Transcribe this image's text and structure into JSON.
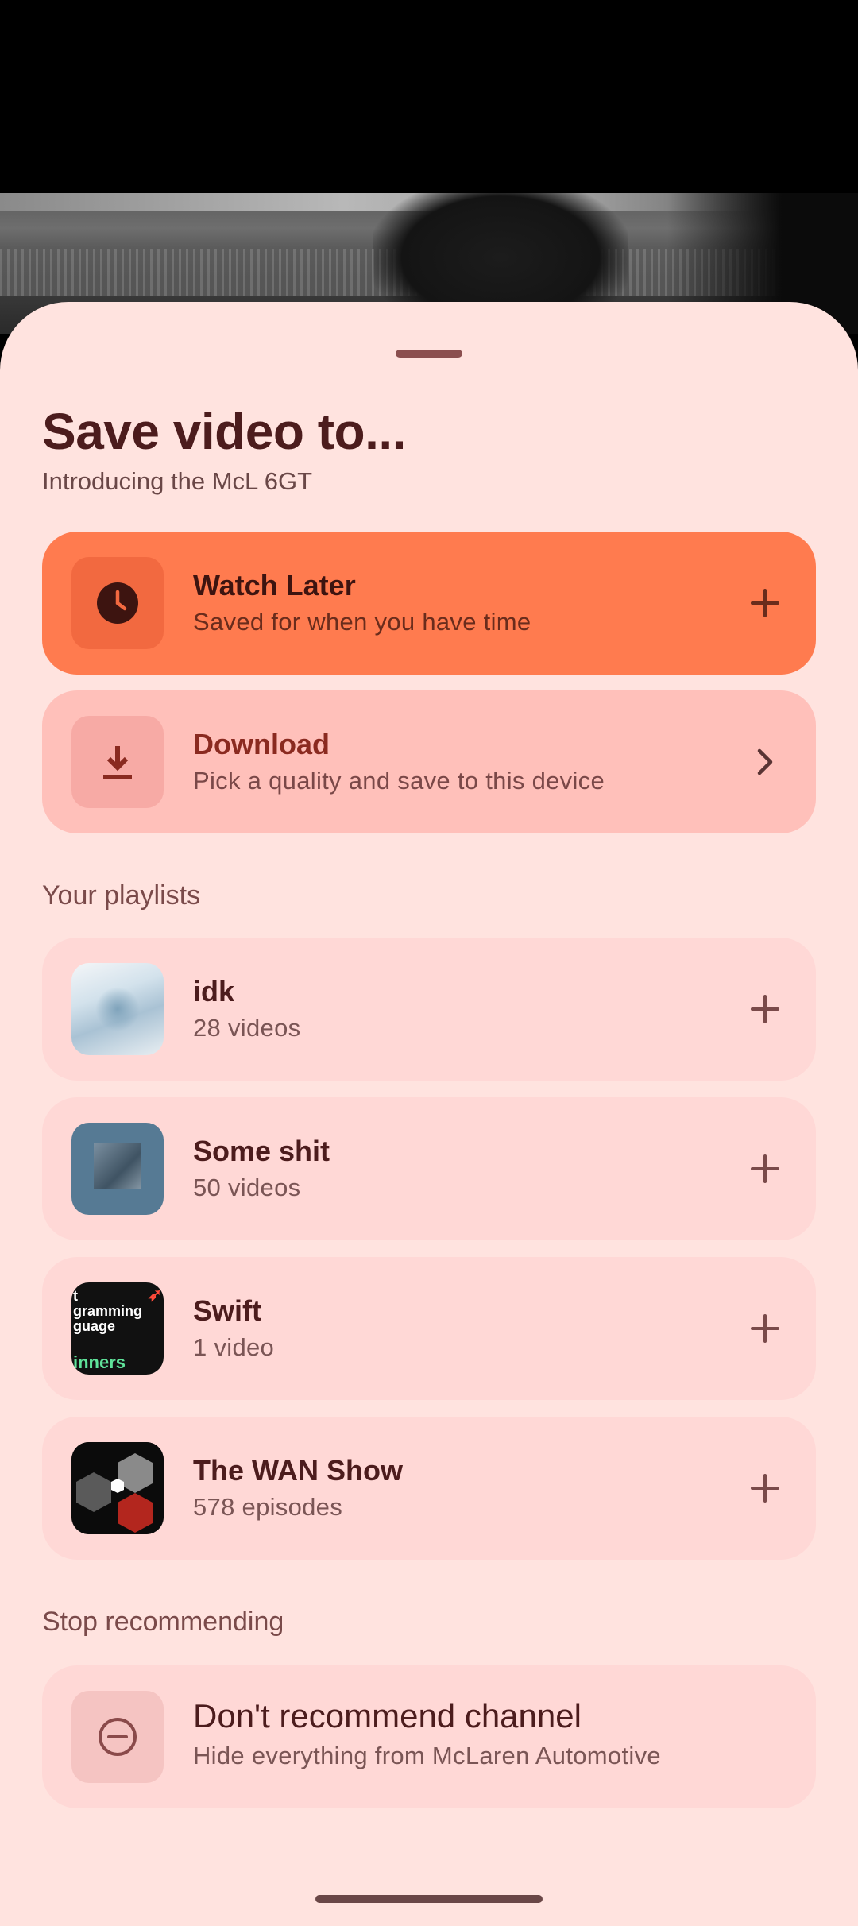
{
  "sheet": {
    "title": "Save video to...",
    "subtitle": "Introducing the McL 6GT"
  },
  "primary_actions": [
    {
      "label": "Watch Later",
      "sub": "Saved for when you have time",
      "icon": "clock-icon",
      "action_icon": "plus-icon"
    },
    {
      "label": "Download",
      "sub": "Pick a quality and save to this device",
      "icon": "download-icon",
      "action_icon": "chevron-right-icon"
    }
  ],
  "playlists_header": "Your playlists",
  "playlists": [
    {
      "name": "idk",
      "count": "28 videos"
    },
    {
      "name": "Some shit",
      "count": "50 videos"
    },
    {
      "name": "Swift",
      "count": "1 video",
      "art_lines": [
        "t",
        "gramming",
        "guage",
        "inners"
      ]
    },
    {
      "name": "The WAN Show",
      "count": "578 episodes"
    }
  ],
  "stop_header": "Stop recommending",
  "recommend": {
    "label": "Don't recommend channel",
    "sub": "Hide everything from McLaren Automotive",
    "icon": "minus-circle-icon"
  },
  "colors": {
    "sheet_bg": "#ffe3df",
    "watch_later_bg": "#ff7b4f",
    "download_bg": "#ffc0ba",
    "card_bg": "#ffd8d6",
    "title_text": "#4c1c1d"
  }
}
